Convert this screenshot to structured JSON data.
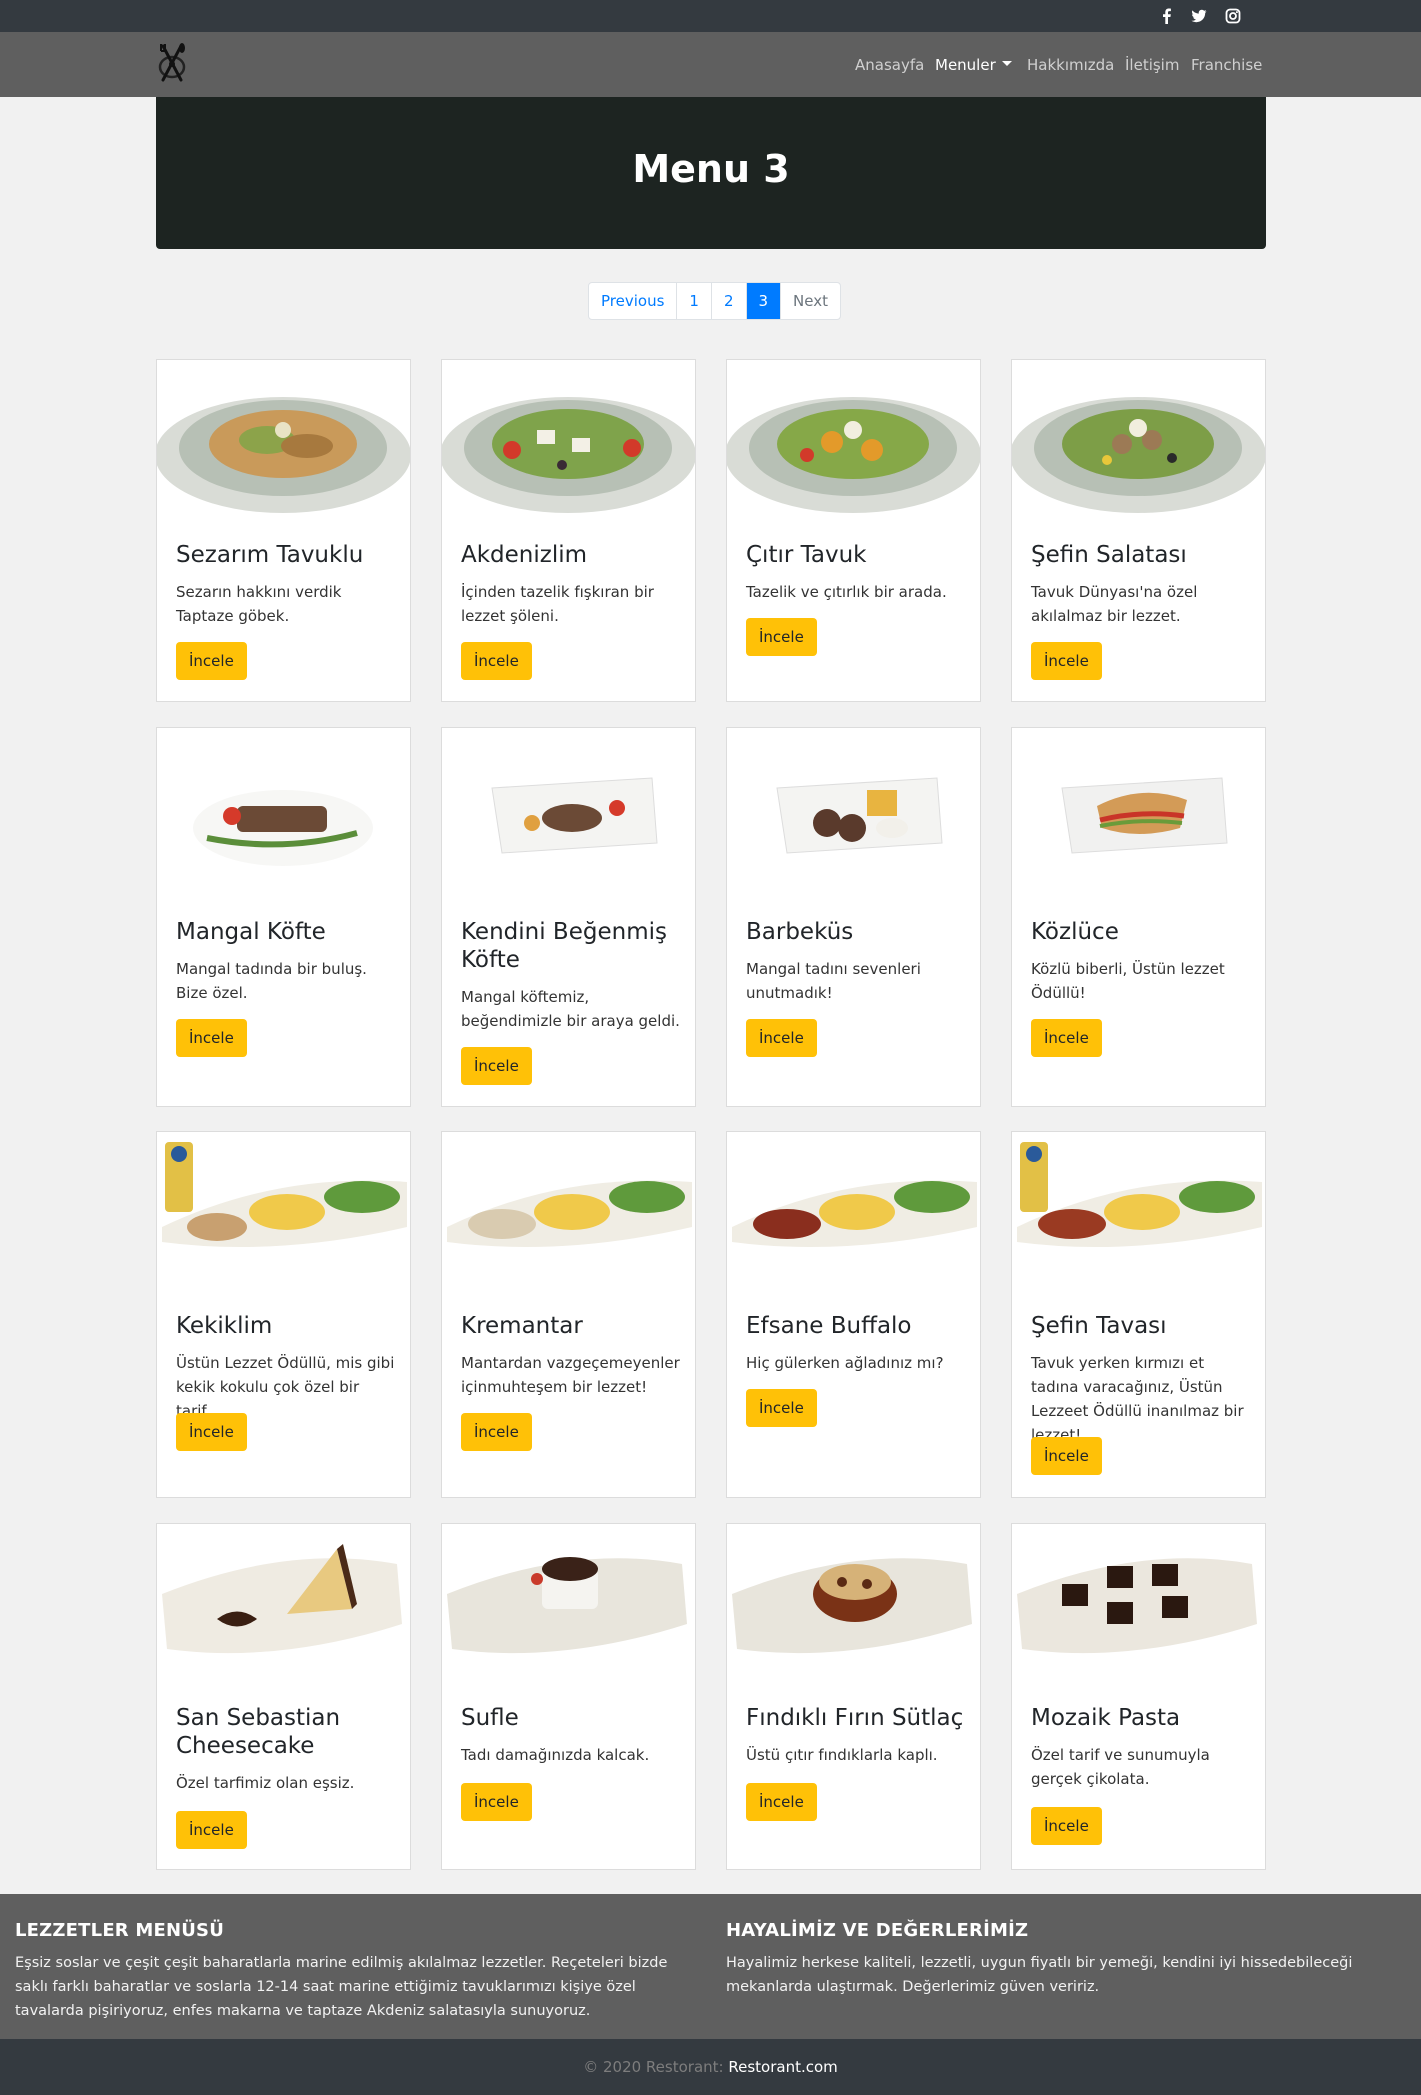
{
  "social": [
    {
      "icon": "facebook-icon"
    },
    {
      "icon": "twitter-icon"
    },
    {
      "icon": "instagram-icon"
    }
  ],
  "nav": {
    "items": [
      "Anasayfa",
      "Menuler",
      "Hakkımızda",
      "İletişim",
      "Franchise"
    ],
    "active": "Menuler"
  },
  "hero": {
    "title": "Menu 3"
  },
  "pagination": {
    "previous": "Previous",
    "pages": [
      "1",
      "2",
      "3"
    ],
    "current": "3",
    "next": "Next"
  },
  "cards": [
    {
      "title": "Sezarım Tavuklu",
      "text": "Sezarın hakkını verdik Taptaze göbek.",
      "button": "İncele"
    },
    {
      "title": "Akdenizlim",
      "text": "İçinden tazelik fışkıran bir lezzet şöleni.",
      "button": "İncele"
    },
    {
      "title": "Çıtır Tavuk",
      "text": "Tazelik ve çıtırlık bir arada.",
      "button": "İncele"
    },
    {
      "title": "Şefin Salatası",
      "text": "Tavuk Dünyası'na özel akılalmaz bir lezzet.",
      "button": "İncele"
    },
    {
      "title": "Mangal Köfte",
      "text": "Mangal tadında bir buluş. Bize özel.",
      "button": "İncele"
    },
    {
      "title": "Kendini Beğenmiş Köfte",
      "text": "Mangal köftemiz, beğendimizle bir araya geldi.",
      "button": "İncele"
    },
    {
      "title": "Barbeküs",
      "text": "Mangal tadını sevenleri unutmadık!",
      "button": "İncele"
    },
    {
      "title": "Közlüce",
      "text": "Közlü biberli, Üstün lezzet Ödüllü!",
      "button": "İncele"
    },
    {
      "title": "Kekiklim",
      "text": "Üstün Lezzet Ödüllü, mis gibi kekik kokulu çok özel bir tarif.",
      "button": "İncele"
    },
    {
      "title": "Kremantar",
      "text": "Mantardan vazgeçemeyenler içinmuhteşem bir lezzet!",
      "button": "İncele"
    },
    {
      "title": "Efsane Buffalo",
      "text": "Hiç gülerken ağladınız mı?",
      "button": "İncele"
    },
    {
      "title": "Şefin Tavası",
      "text": "Tavuk yerken kırmızı et tadına varacağınız, Üstün Lezzeet Ödüllü inanılmaz bir lezzet!",
      "button": "İncele"
    },
    {
      "title": "San Sebastian Cheesecake",
      "text": "Özel tarfimiz olan eşsiz.",
      "button": "İncele"
    },
    {
      "title": "Sufle",
      "text": "Tadı damağınızda kalcak.",
      "button": "İncele"
    },
    {
      "title": "Fındıklı Fırın Sütlaç",
      "text": "Üstü çıtır fındıklarla kaplı.",
      "button": "İncele"
    },
    {
      "title": "Mozaik Pasta",
      "text": "Özel tarif ve sunumuyla gerçek çikolata.",
      "button": "İncele"
    }
  ],
  "footer": {
    "left_title": "LEZZETLER MENÜSÜ",
    "left_text": "Eşsiz soslar ve çeşit çeşit baharatlarla marine edilmiş akılalmaz lezzetler. Reçeteleri bizde saklı farklı baharatlar ve soslarla 12-14 saat marine ettiğimiz tavuklarımızı kişiye özel tavalarda pişiriyoruz, enfes makarna ve taptaze Akdeniz salatasıyla sunuyoruz.",
    "right_title": "HAYALİMİZ VE DEĞERLERİMİZ",
    "right_text": "Hayalimiz herkese kaliteli, lezzetli, uygun fiyatlı bir yemeği, kendini iyi hissedebileceği mekanlarda ulaştırmak. Değerlerimiz güven veririz."
  },
  "copyright": {
    "text": "© 2020 Restorant: ",
    "brand": "Restorant.com"
  }
}
